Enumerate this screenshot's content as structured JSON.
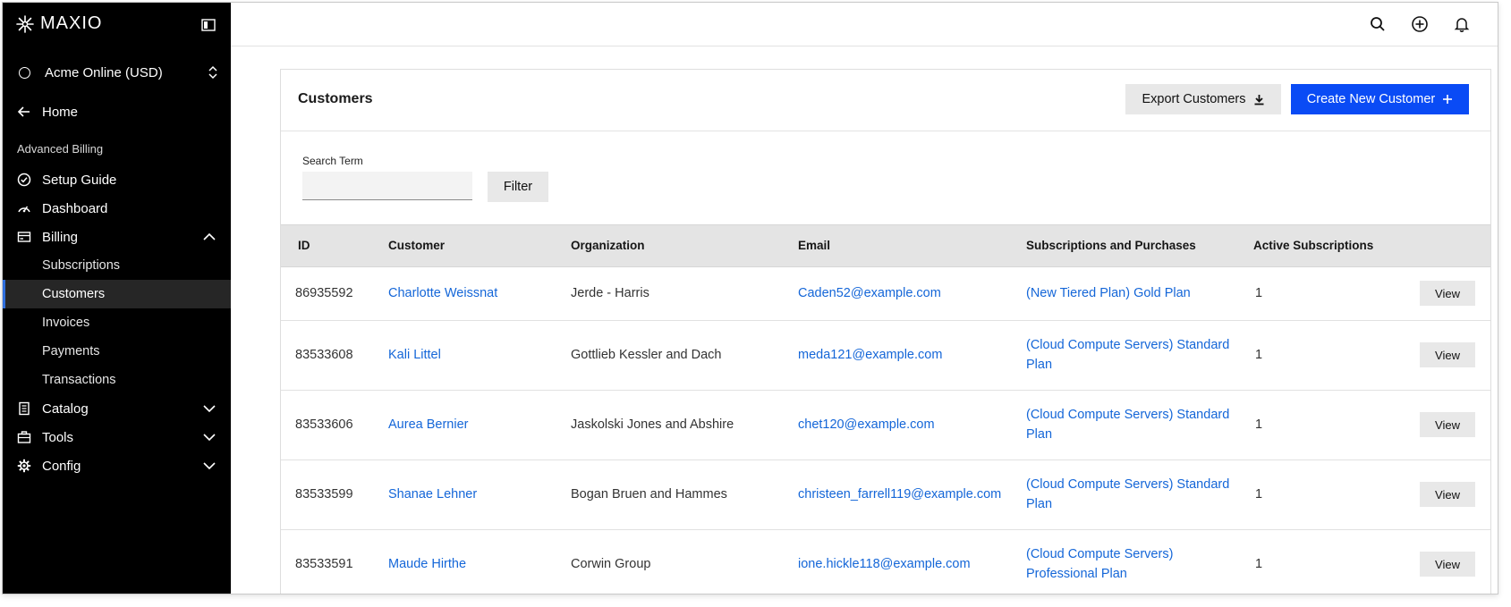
{
  "brand": {
    "wordmark": "MAXIO"
  },
  "sidebar": {
    "site_selector": "Acme Online (USD)",
    "home": "Home",
    "section_label": "Advanced Billing",
    "items": [
      {
        "label": "Setup Guide",
        "icon": "check-circle-icon"
      },
      {
        "label": "Dashboard",
        "icon": "gauge-icon"
      },
      {
        "label": "Billing",
        "icon": "credit-card-icon",
        "expanded": true
      },
      {
        "label": "Catalog",
        "icon": "document-icon",
        "expanded": false
      },
      {
        "label": "Tools",
        "icon": "briefcase-icon",
        "expanded": false
      },
      {
        "label": "Config",
        "icon": "gear-icon",
        "expanded": false
      }
    ],
    "billing_sub": [
      "Subscriptions",
      "Customers",
      "Invoices",
      "Payments",
      "Transactions"
    ],
    "active_sub": "Customers"
  },
  "topbar": {
    "icons": [
      "search-icon",
      "add-circle-icon",
      "bell-icon"
    ]
  },
  "page": {
    "title": "Customers",
    "export_label": "Export Customers",
    "create_label": "Create New Customer",
    "search_label": "Search Term",
    "search_value": "",
    "filter_label": "Filter"
  },
  "table": {
    "columns": [
      "ID",
      "Customer",
      "Organization",
      "Email",
      "Subscriptions and Purchases",
      "Active Subscriptions"
    ],
    "view_label": "View",
    "rows": [
      {
        "id": "86935592",
        "customer": "Charlotte Weissnat",
        "organization": "Jerde - Harris",
        "email": "Caden52@example.com",
        "subs_line1": "(New Tiered Plan) Gold Plan",
        "subs_line2": "",
        "active": "1"
      },
      {
        "id": "83533608",
        "customer": "Kali Littel",
        "organization": "Gottlieb Kessler and Dach",
        "email": "meda121@example.com",
        "subs_line1": "(Cloud Compute Servers) Standard",
        "subs_line2": "Plan",
        "active": "1"
      },
      {
        "id": "83533606",
        "customer": "Aurea Bernier",
        "organization": "Jaskolski Jones and Abshire",
        "email": "chet120@example.com",
        "subs_line1": "(Cloud Compute Servers) Standard",
        "subs_line2": "Plan",
        "active": "1"
      },
      {
        "id": "83533599",
        "customer": "Shanae Lehner",
        "organization": "Bogan Bruen and Hammes",
        "email": "christeen_farrell119@example.com",
        "subs_line1": "(Cloud Compute Servers) Standard",
        "subs_line2": "Plan",
        "active": "1"
      },
      {
        "id": "83533591",
        "customer": "Maude Hirthe",
        "organization": "Corwin Group",
        "email": "ione.hickle118@example.com",
        "subs_line1": "(Cloud Compute Servers)",
        "subs_line2": "Professional Plan",
        "active": "1"
      }
    ]
  },
  "colors": {
    "sidebar_bg": "#000000",
    "primary": "#0a4bf5",
    "link": "#1466d8",
    "active_indicator": "#2f6fde"
  }
}
